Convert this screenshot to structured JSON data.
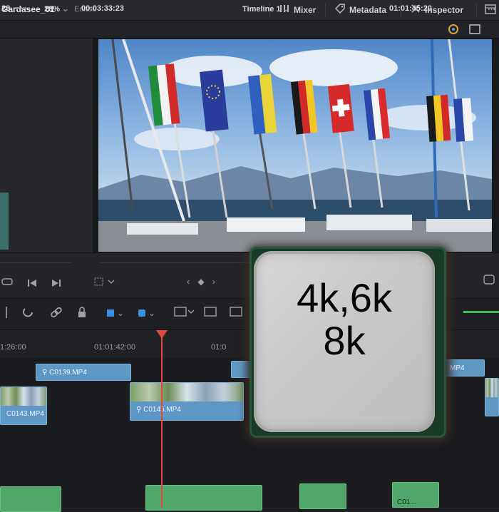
{
  "topbar": {
    "project_name": "Gardasee_01",
    "status": "Edited",
    "mixer_label": "Mixer",
    "metadata_label": "Metadata",
    "inspector_label": "Inspector"
  },
  "viewer_header": {
    "left_value": "28",
    "zoom": "28%",
    "source_timecode": "00:03:33:23",
    "timeline_name": "Timeline 1",
    "record_timecode": "01:01:45:20"
  },
  "ruler": {
    "timecodes": [
      "1:26:00",
      "01:01:42:00",
      "01:0"
    ]
  },
  "clips": {
    "c0139": "C0139.MP4",
    "c0143": "C0143.MP4",
    "c0145": "C0145.MP4",
    "right_clip": "MP4",
    "audio_partial": "C01..."
  },
  "cpu_overlay": {
    "line1": "4k,6k",
    "line2": "8k"
  },
  "colors": {
    "clip_blue": "#5f97c4",
    "audio_green": "#4fa86a",
    "playhead_red": "#e0483c",
    "cpu_silver": "#c9c9c9"
  }
}
